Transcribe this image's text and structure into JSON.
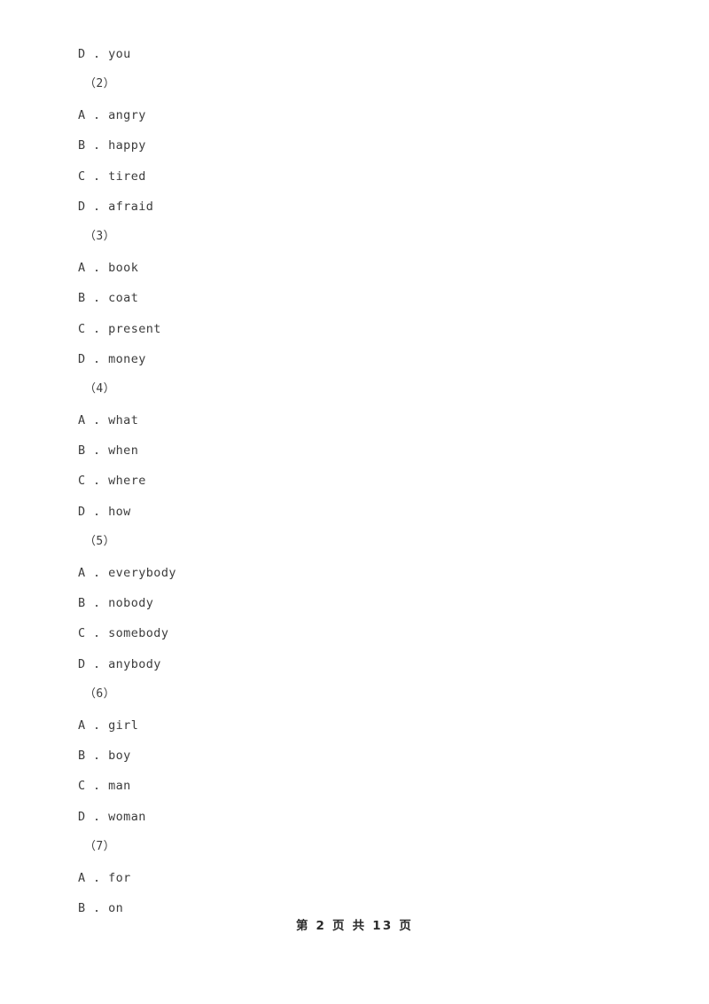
{
  "document": {
    "footer": "第 2 页 共 13 页"
  },
  "content": {
    "separator": " . ",
    "lines": [
      {
        "kind": "option",
        "letter": "D",
        "text": "you"
      },
      {
        "kind": "group",
        "label": "（2）"
      },
      {
        "kind": "option",
        "letter": "A",
        "text": "angry"
      },
      {
        "kind": "option",
        "letter": "B",
        "text": "happy"
      },
      {
        "kind": "option",
        "letter": "C",
        "text": "tired"
      },
      {
        "kind": "option",
        "letter": "D",
        "text": "afraid"
      },
      {
        "kind": "group",
        "label": "（3）"
      },
      {
        "kind": "option",
        "letter": "A",
        "text": "book"
      },
      {
        "kind": "option",
        "letter": "B",
        "text": "coat"
      },
      {
        "kind": "option",
        "letter": "C",
        "text": "present"
      },
      {
        "kind": "option",
        "letter": "D",
        "text": "money"
      },
      {
        "kind": "group",
        "label": "（4）"
      },
      {
        "kind": "option",
        "letter": "A",
        "text": "what"
      },
      {
        "kind": "option",
        "letter": "B",
        "text": "when"
      },
      {
        "kind": "option",
        "letter": "C",
        "text": "where"
      },
      {
        "kind": "option",
        "letter": "D",
        "text": "how"
      },
      {
        "kind": "group",
        "label": "（5）"
      },
      {
        "kind": "option",
        "letter": "A",
        "text": "everybody"
      },
      {
        "kind": "option",
        "letter": "B",
        "text": "nobody"
      },
      {
        "kind": "option",
        "letter": "C",
        "text": "somebody"
      },
      {
        "kind": "option",
        "letter": "D",
        "text": "anybody"
      },
      {
        "kind": "group",
        "label": "（6）"
      },
      {
        "kind": "option",
        "letter": "A",
        "text": "girl"
      },
      {
        "kind": "option",
        "letter": "B",
        "text": "boy"
      },
      {
        "kind": "option",
        "letter": "C",
        "text": "man"
      },
      {
        "kind": "option",
        "letter": "D",
        "text": "woman"
      },
      {
        "kind": "group",
        "label": "（7）"
      },
      {
        "kind": "option",
        "letter": "A",
        "text": "for"
      },
      {
        "kind": "option",
        "letter": "B",
        "text": "on"
      }
    ]
  }
}
